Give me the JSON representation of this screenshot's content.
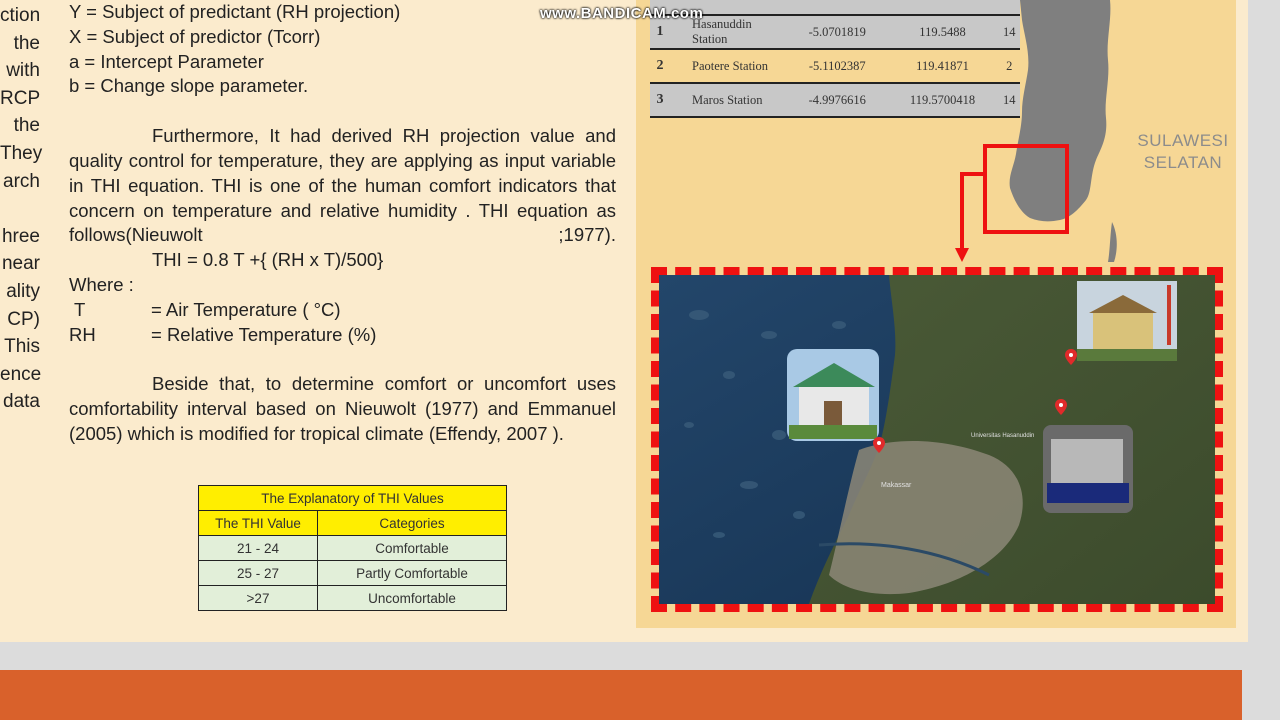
{
  "watermark": "www.BANDICAM.com",
  "left_fragments": [
    "ction",
    "the",
    "with",
    "RCP",
    "the",
    "They",
    "arch",
    "",
    "hree",
    "near",
    "ality",
    "CP)",
    "This",
    "ence",
    "data"
  ],
  "definitions": [
    "Y = Subject of predictant (RH projection)",
    "X = Subject of predictor (Tcorr)",
    "a = Intercept Parameter",
    "b = Change slope parameter."
  ],
  "paragraph_thi": "Furthermore, It had derived RH projection value and quality control for temperature, they are applying as input variable in THI equation. THI is one of the human comfort indicators that concern on temperature and relative humidity . THI equation as follows(Nieuwolt ;1977).",
  "equation": "THI = 0.8 T +{ (RH x T)/500}",
  "where_label": "Where :",
  "variables": [
    {
      "key": "T",
      "value": "= Air Temperature ( °C)"
    },
    {
      "key": "RH",
      "value": "= Relative Temperature (%)"
    }
  ],
  "paragraph_comfort": "Beside that, to determine comfort or uncomfort uses comfortability interval based on Nieuwolt (1977) and Emmanuel (2005) which is modified for tropical climate (Effendy, 2007 ).",
  "thi_table": {
    "caption": "The Explanatory of THI Values",
    "headers": [
      "The THI Value",
      "Categories"
    ],
    "rows": [
      [
        "21 - 24",
        "Comfortable"
      ],
      [
        "25 - 27",
        "Partly Comfortable"
      ],
      [
        ">27",
        "Uncomfortable"
      ]
    ]
  },
  "station_table": {
    "rows": [
      {
        "no": "1",
        "name": "Hasanuddin Station",
        "lat": "-5.0701819",
        "lon": "119.5488",
        "elev": "14"
      },
      {
        "no": "2",
        "name": "Paotere Station",
        "lat": "-5.1102387",
        "lon": "119.41871",
        "elev": "2"
      },
      {
        "no": "3",
        "name": "Maros Station",
        "lat": "-4.9976616",
        "lon": "119.5700418",
        "elev": "14"
      }
    ]
  },
  "island_label": [
    "SULAWESI",
    "SELATAN"
  ],
  "map_labels": {
    "city": "Makassar",
    "campus": "Universitas Hasanuddin"
  },
  "colors": {
    "poster_bg": "#fbebcd",
    "right_panel_bg": "#f6d795",
    "accent_band": "#d9612b",
    "table_header_yellow": "#ffee00",
    "table_body_green": "#e2efd9",
    "highlight_red": "#ee1111",
    "landmass_gray": "#7f7f7f"
  }
}
